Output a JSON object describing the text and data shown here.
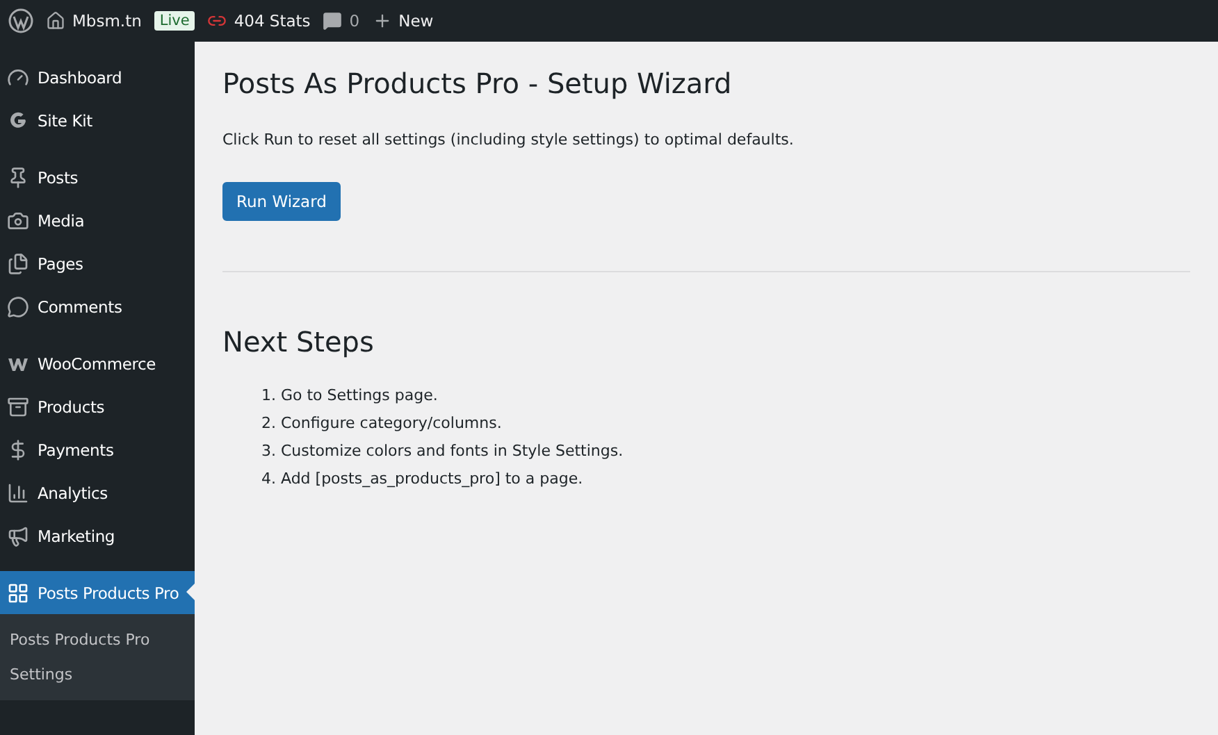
{
  "admin_bar": {
    "site": "Mbsm.tn",
    "badge": "Live",
    "stats": "404 Stats",
    "comments": "0",
    "new": "New"
  },
  "sidebar": {
    "groups": [
      [
        {
          "label": "Dashboard",
          "selected": false
        },
        {
          "label": "Site Kit",
          "selected": false
        }
      ],
      [
        {
          "label": "Posts",
          "selected": false
        },
        {
          "label": "Media",
          "selected": false
        },
        {
          "label": "Pages",
          "selected": false
        },
        {
          "label": "Comments",
          "selected": false
        }
      ],
      [
        {
          "label": "WooCommerce",
          "selected": false
        },
        {
          "label": "Products",
          "selected": false
        },
        {
          "label": "Payments",
          "selected": false
        },
        {
          "label": "Analytics",
          "selected": false
        },
        {
          "label": "Marketing",
          "selected": false
        }
      ],
      [
        {
          "label": "Posts Products Pro",
          "selected": true
        }
      ]
    ],
    "submenu": [
      "Posts Products Pro",
      "Settings"
    ]
  },
  "main": {
    "title": "Posts As Products Pro - Setup Wizard",
    "description": "Click Run to reset all settings (including style settings) to optimal defaults.",
    "button": "Run Wizard",
    "next_title": "Next Steps",
    "steps": [
      "1. Go to Settings page.",
      "2. Configure category/columns.",
      "3. Customize colors and fonts in Style Settings.",
      "4. Add [posts_as_products_pro] to a page."
    ]
  }
}
